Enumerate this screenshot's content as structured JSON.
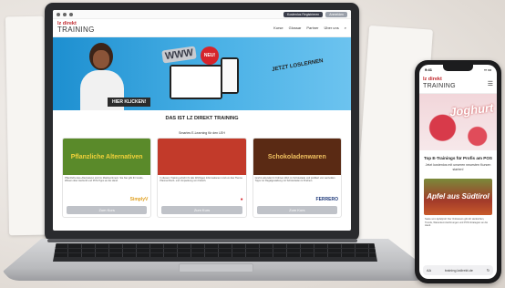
{
  "site": {
    "brand_top": "lz direkt",
    "brand_main": "TRAINING",
    "topbar": {
      "btn_register": "Kostenlos Registrieren",
      "btn_login": "Anmelden"
    },
    "menu": [
      "Kurse",
      "Glossar",
      "Partner",
      "Über uns"
    ],
    "hero": {
      "www": "WWW",
      "neu": "NEU!",
      "jetzt": "JETZT LOSLERNEN",
      "cta": "HIER KLICKEN!"
    },
    "section_title": "DAS IST LZ DIREKT TRAINING",
    "section_sub": "Smartes E-Learning für den LEH",
    "cards": [
      {
        "img_text": "Pflanzliche Alternativen",
        "img_bg": "#5a8a2a",
        "text": "Pflanzliche Ess-Alternativen sind im Marktsortiment. Sie hier gibt Ihr Gratis-Wissen über Herkunft und POS-Tipps an die Hand.",
        "brand": "SimplyV",
        "brand_color": "#e0a020",
        "button": "Zum Kurs"
      },
      {
        "img_text": "",
        "img_bg": "#c23a2a",
        "text": "In diesem Training erfahrt ihr alle Wichtigen Informationen rund um das Thema Pfannenfrisch- und Umpackung von Fleisch.",
        "brand": "●",
        "brand_color": "#d6242b",
        "button": "Zum Kurs"
      },
      {
        "img_text": "Schokoladenwaren",
        "img_bg": "#5a2a14",
        "text": "Graf & erkundet ihr Kühnen Wert zu Schokolade und profitiert von wertvollen Tipps zur Regalgestaltung mit Schokoladen & Pralinen.",
        "brand": "FERRERO",
        "brand_color": "#1f3a7a",
        "button": "Zum Kurs"
      }
    ]
  },
  "phone": {
    "time": "9:41",
    "joghurt": "Joghurt",
    "title": "Top E-Trainings für Profis am POS",
    "sub": "Jetzt kostenlos mit unseren neuesten Kursen starten!",
    "apfel": "Apfel aus Südtirol",
    "text": "Seele vom Apfelprofi: Der Onlinekurs gibt dir Herkünften, Trends, Warenkennzeichnungen und POS-Strategien an die Hand.",
    "url": "training.lzdirekt.de"
  }
}
